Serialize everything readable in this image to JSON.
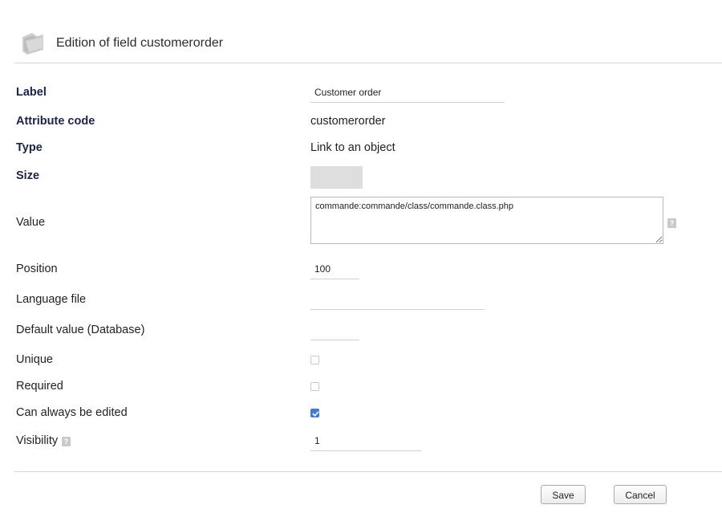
{
  "header": {
    "title": "Edition of field customerorder",
    "icon": "folder-icon"
  },
  "fields": {
    "label": {
      "label": "Label",
      "value": "Customer order"
    },
    "attribute_code": {
      "label": "Attribute code",
      "value": "customerorder"
    },
    "type": {
      "label": "Type",
      "value": "Link to an object"
    },
    "size": {
      "label": "Size",
      "value": ""
    },
    "value": {
      "label": "Value",
      "value": "commande:commande/class/commande.class.php",
      "help": "?"
    },
    "position": {
      "label": "Position",
      "value": "100"
    },
    "language_file": {
      "label": "Language file",
      "value": ""
    },
    "default_value": {
      "label": "Default value (Database)",
      "value": ""
    },
    "unique": {
      "label": "Unique",
      "checked": false
    },
    "required": {
      "label": "Required",
      "checked": false
    },
    "always_editable": {
      "label": "Can always be edited",
      "checked": true
    },
    "visibility": {
      "label": "Visibility",
      "value": "1",
      "help": "?"
    }
  },
  "buttons": {
    "save": "Save",
    "cancel": "Cancel"
  },
  "colors": {
    "label_bold": "#1c2250",
    "checkbox_checked": "#3b7be2"
  }
}
